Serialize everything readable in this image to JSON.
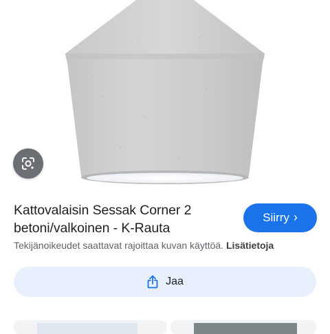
{
  "product": {
    "title_line1": "Kattovalaisin Sessak Corner 2",
    "title_line2": "betoni/valkoinen - K-Rauta"
  },
  "actions": {
    "visit_label": "Siirry",
    "visit_chevron": "›",
    "share_label": "Jaa"
  },
  "notice": {
    "text": "Tekijänoikeudet saattavat rajoittaa kuvan käyttöä.",
    "more_link": "Lisätietoja"
  },
  "colors": {
    "accent": "#1a73e8",
    "share_bg": "#e8f0fe",
    "concrete": "#cfd0cf"
  },
  "icons": {
    "lens": "lens-icon",
    "share": "share-icon",
    "visit": "chevron-right-icon"
  }
}
